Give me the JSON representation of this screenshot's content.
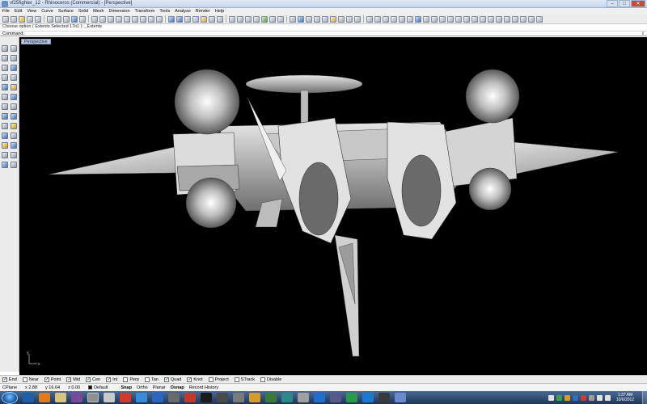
{
  "window": {
    "title": "vf25fighter_12 - Rhinoceros (Commercial) - [Perspective]",
    "controls": [
      "–",
      "□",
      "✕"
    ]
  },
  "menu": [
    "File",
    "Edit",
    "View",
    "Curve",
    "Surface",
    "Solid",
    "Mesh",
    "Dimension",
    "Transform",
    "Tools",
    "Analyze",
    "Render",
    "Help"
  ],
  "history": {
    "line": "Choose option ( Extents  Selected  1To1 ): _Extents"
  },
  "command": {
    "prompt": "Command:",
    "scroll_glyph": "⇕"
  },
  "viewport": {
    "tab": "Perspective",
    "axis_y": "y",
    "axis_x": "x"
  },
  "osnap": [
    {
      "label": "End",
      "checked": true
    },
    {
      "label": "Near",
      "checked": false
    },
    {
      "label": "Point",
      "checked": true
    },
    {
      "label": "Mid",
      "checked": true
    },
    {
      "label": "Cen",
      "checked": true
    },
    {
      "label": "Int",
      "checked": true
    },
    {
      "label": "Perp",
      "checked": false
    },
    {
      "label": "Tan",
      "checked": false
    },
    {
      "label": "Quad",
      "checked": true
    },
    {
      "label": "Knot",
      "checked": true
    },
    {
      "label": "Project",
      "checked": false
    },
    {
      "label": "STrack",
      "checked": false
    },
    {
      "label": "Disable",
      "checked": false
    }
  ],
  "status": {
    "cplane": "CPlane",
    "x": "x 2.88",
    "y": "y 16.64",
    "z": "z 0.00",
    "layer": "Default",
    "toggles": [
      "Snap",
      "Ortho",
      "Planar",
      "Osnap",
      "Record History"
    ],
    "bold_toggles": [
      "Snap",
      "Osnap"
    ]
  },
  "clock": {
    "time": "1:37 AM",
    "date": "10/6/2012"
  },
  "colors": {
    "viewport_bg": "#000000",
    "model": "#d9d9d9",
    "taskbar": "#27436b"
  }
}
